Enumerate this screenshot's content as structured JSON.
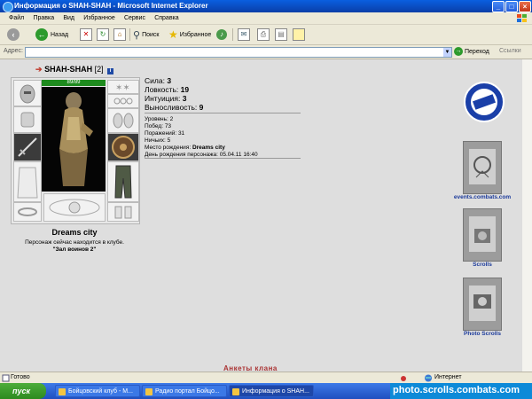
{
  "window": {
    "title": "Информация о SHAH-SHAH - Microsoft Internet Explorer",
    "minimize": "_",
    "maximize": "□",
    "close": "×"
  },
  "menu": [
    "Файл",
    "Правка",
    "Вид",
    "Избранное",
    "Сервис",
    "Справка"
  ],
  "toolbar": {
    "back_label": "Назад",
    "search_label": "Поиск",
    "favorites_label": "Избранное"
  },
  "address": {
    "label": "Адрес:",
    "value": "",
    "go_label": "Переход",
    "links_label": "Ссылки"
  },
  "character": {
    "name": "SHAH-SHAH",
    "level": "[2]",
    "hp": "89/89",
    "location_city": "Dreams city",
    "location_status": "Персонаж сейчас находится в клубе.",
    "location_club": "\"Зал воинов 2\""
  },
  "stats": [
    {
      "label": "Сила:",
      "value": "3"
    },
    {
      "label": "Ловкость:",
      "value": "19"
    },
    {
      "label": "Интуиция:",
      "value": "3"
    },
    {
      "label": "Выносливость:",
      "value": "9"
    }
  ],
  "details": {
    "level": "Уровень: 2",
    "wins": "Побед: 73",
    "losses": "Поражений: 31",
    "draws": "Ничьих: 5",
    "birthplace_label": "Место рождения: ",
    "birthplace_value": "Dreams city",
    "birthday": "День рождения персонажа: 05.04.11 16:40"
  },
  "banners": [
    {
      "label": "events.combats.com",
      "icon": "events-banner-icon"
    },
    {
      "label": "Scrolls",
      "icon": "scrolls-banner-icon"
    },
    {
      "label": "Photo Scrolls",
      "icon": "photo-scrolls-banner-icon"
    }
  ],
  "bottom_fragment": "Анкеты клана",
  "status": {
    "ready": "Готово",
    "zone": "Интернет"
  },
  "taskbar": {
    "start": "пуск",
    "tasks": [
      "Бойцовский клуб - М...",
      "Радио портал Бойцо...",
      "Информация о SHAH..."
    ],
    "watermark": "photo.scrolls.combats.com"
  }
}
